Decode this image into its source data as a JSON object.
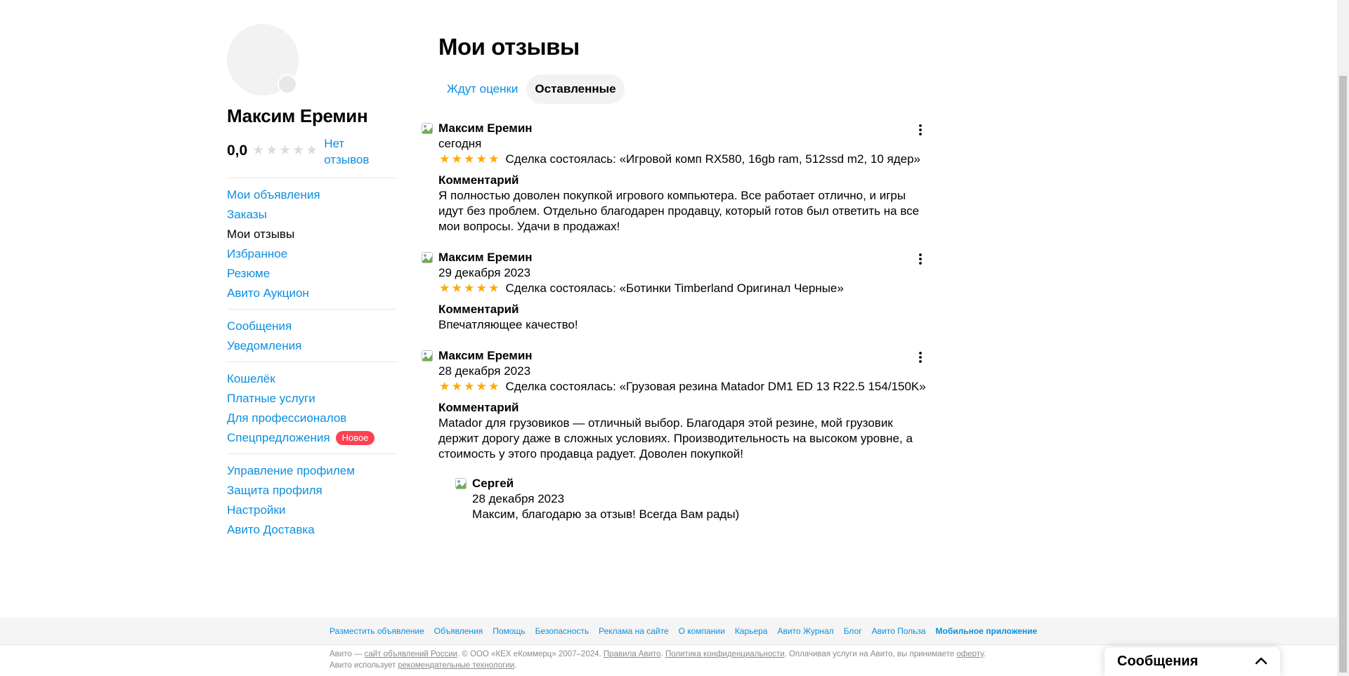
{
  "profile": {
    "name": "Максим Еремин",
    "rating": "0,0",
    "stars_filled": 0,
    "no_reviews": "Нет отзывов"
  },
  "menu": {
    "groups": [
      [
        {
          "label": "Мои объявления",
          "active": false
        },
        {
          "label": "Заказы",
          "active": false
        },
        {
          "label": "Мои отзывы",
          "active": true
        },
        {
          "label": "Избранное",
          "active": false
        },
        {
          "label": "Резюме",
          "active": false
        },
        {
          "label": "Авито Аукцион",
          "active": false
        }
      ],
      [
        {
          "label": "Сообщения",
          "active": false
        },
        {
          "label": "Уведомления",
          "active": false
        }
      ],
      [
        {
          "label": "Кошелёк",
          "active": false
        },
        {
          "label": "Платные услуги",
          "active": false
        },
        {
          "label": "Для профессионалов",
          "active": false
        },
        {
          "label": "Спецпредложения",
          "active": false,
          "badge": "Новое"
        }
      ],
      [
        {
          "label": "Управление профилем",
          "active": false
        },
        {
          "label": "Защита профиля",
          "active": false
        },
        {
          "label": "Настройки",
          "active": false
        },
        {
          "label": "Авито Доставка",
          "active": false
        }
      ]
    ]
  },
  "main": {
    "title": "Мои отзывы",
    "tabs": [
      {
        "label": "Ждут оценки",
        "active": false
      },
      {
        "label": "Оставленные",
        "active": true
      }
    ],
    "reviews": [
      {
        "author": "Максим Еремин",
        "date": "сегодня",
        "stars": 5,
        "deal": "Сделка состоялась: «Игровой комп RX580, 16gb ram, 512ssd m2, 10 ядер»",
        "comment_label": "Комментарий",
        "comment": "Я полностью доволен покупкой игрового компьютера. Все работает отлично, и игры идут без проблем. Отдельно благодарен продавцу, который готов был ответить на все мои вопросы. Удачи в продажах!"
      },
      {
        "author": "Максим Еремин",
        "date": "29 декабря 2023",
        "stars": 5,
        "deal": "Сделка состоялась: «Ботинки Timberland Оригинал Черные»",
        "comment_label": "Комментарий",
        "comment": "Впечатляющее качество!"
      },
      {
        "author": "Максим Еремин",
        "date": "28 декабря 2023",
        "stars": 5,
        "deal": "Сделка состоялась: «Грузовая резина Matador DM1 ED 13 R22.5 154/150K»",
        "comment_label": "Комментарий",
        "comment": "Matador для грузовиков — отличный выбор. Благодаря этой резине, мой грузовик держит дорогу даже в сложных условиях. Производительность на высоком уровне, а стоимость у этого продавца радует. Доволен покупкой!",
        "reply": {
          "author": "Сергей",
          "date": "28 декабря 2023",
          "text": "Максим, благодарю за отзыв! Всегда Вам рады)"
        }
      }
    ]
  },
  "footer": {
    "links": [
      {
        "label": "Разместить объявление",
        "bold": false
      },
      {
        "label": "Объявления",
        "bold": false
      },
      {
        "label": "Помощь",
        "bold": false
      },
      {
        "label": "Безопасность",
        "bold": false
      },
      {
        "label": "Реклама на сайте",
        "bold": false
      },
      {
        "label": "О компании",
        "bold": false
      },
      {
        "label": "Карьера",
        "bold": false
      },
      {
        "label": "Авито Журнал",
        "bold": false
      },
      {
        "label": "Блог",
        "bold": false
      },
      {
        "label": "Авито Польза",
        "bold": false
      },
      {
        "label": "Мобильное приложение",
        "bold": true
      }
    ],
    "legal": {
      "t1": "Авито — ",
      "l1": "сайт объявлений России",
      "t2": ". © ООО «КЕХ еКоммерц» 2007–2024. ",
      "l2": "Правила Авито",
      "t3": ". ",
      "l3": "Политика конфиденциальности",
      "t4": ". Оплачивая услуги на Авито, вы принимаете ",
      "l4": "оферту",
      "t5": ". Авито использует ",
      "l5": "рекомендательные технологии",
      "t6": "."
    }
  },
  "messages_panel": {
    "title": "Сообщения"
  },
  "colors": {
    "link": "#0a8fe0",
    "star": "#ffa800",
    "badge": "#ff4053"
  }
}
